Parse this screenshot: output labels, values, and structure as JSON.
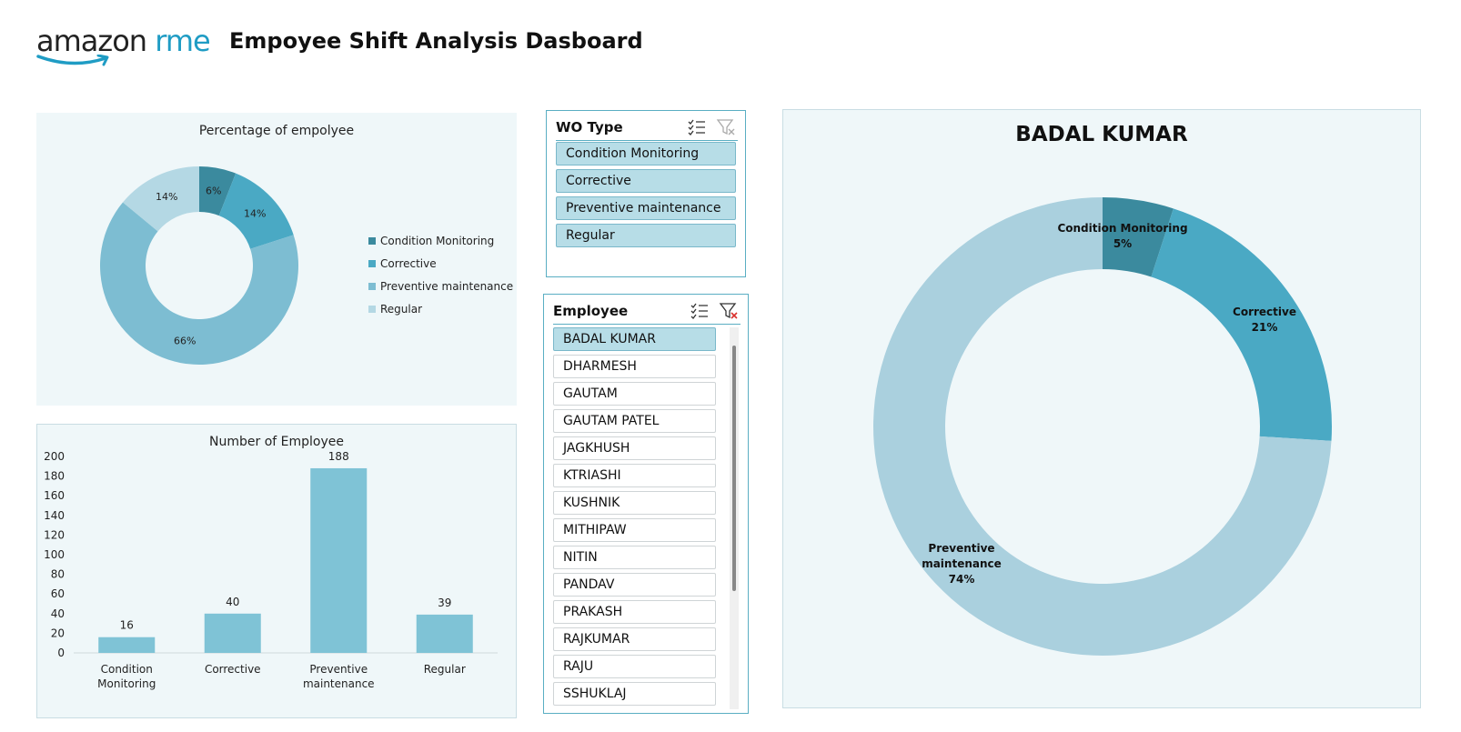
{
  "header": {
    "logo_word": "amazon",
    "logo_suffix": "rme",
    "title": "Empoyee Shift Analysis Dasboard"
  },
  "colors": {
    "condition_monitoring": "#3b8a9e",
    "corrective": "#4aa9c4",
    "preventive_maintenance": "#7dbdd2",
    "regular": "#b4d8e4",
    "big_preventive": "#aad0de",
    "bar": "#7fc3d6",
    "panel_bg": "#eff7f9",
    "slicer_border": "#5aaec3"
  },
  "wo_slicer": {
    "title": "WO Type",
    "items": [
      {
        "label": "Condition Monitoring",
        "selected": true
      },
      {
        "label": "Corrective",
        "selected": true
      },
      {
        "label": "Preventive maintenance",
        "selected": true
      },
      {
        "label": "Regular",
        "selected": true
      }
    ]
  },
  "employee_slicer": {
    "title": "Employee",
    "items": [
      {
        "label": "BADAL KUMAR",
        "selected": true
      },
      {
        "label": "DHARMESH",
        "selected": false
      },
      {
        "label": "GAUTAM",
        "selected": false
      },
      {
        "label": "GAUTAM PATEL",
        "selected": false
      },
      {
        "label": "JAGKHUSH",
        "selected": false
      },
      {
        "label": "KTRIASHI",
        "selected": false
      },
      {
        "label": "KUSHNIK",
        "selected": false
      },
      {
        "label": "MITHIPAW",
        "selected": false
      },
      {
        "label": "NITIN",
        "selected": false
      },
      {
        "label": "PANDAV",
        "selected": false
      },
      {
        "label": "PRAKASH",
        "selected": false
      },
      {
        "label": "RAJKUMAR",
        "selected": false
      },
      {
        "label": "RAJU",
        "selected": false
      },
      {
        "label": "SSHUKLAJ",
        "selected": false
      }
    ]
  },
  "chart_data": [
    {
      "type": "pie",
      "variant": "donut",
      "title": "Percentage of empolyee",
      "categories": [
        "Condition Monitoring",
        "Corrective",
        "Preventive maintenance",
        "Regular"
      ],
      "values": [
        6,
        14,
        66,
        14
      ],
      "labels": [
        "6%",
        "14%",
        "66%",
        "14%"
      ],
      "legend": "right"
    },
    {
      "type": "bar",
      "title": "Number of Employee",
      "categories": [
        "Condition Monitoring",
        "Corrective",
        "Preventive maintenance",
        "Regular"
      ],
      "category_lines": [
        [
          "Condition",
          "Monitoring"
        ],
        [
          "Corrective"
        ],
        [
          "Preventive",
          "maintenance"
        ],
        [
          "Regular"
        ]
      ],
      "values": [
        16,
        40,
        188,
        39
      ],
      "ylim": [
        0,
        200
      ],
      "yticks": [
        0,
        20,
        40,
        60,
        80,
        100,
        120,
        140,
        160,
        180,
        200
      ],
      "grid": false
    },
    {
      "type": "pie",
      "variant": "donut",
      "title": "BADAL KUMAR",
      "categories": [
        "Condition Monitoring",
        "Corrective",
        "Preventive maintenance"
      ],
      "values": [
        5,
        21,
        74
      ],
      "labels": [
        "5%",
        "21%",
        "74%"
      ],
      "label_lines": [
        [
          "Condition Monitoring",
          "5%"
        ],
        [
          "Corrective",
          "21%"
        ],
        [
          "Preventive",
          "maintenance",
          "74%"
        ]
      ],
      "legend": "none"
    }
  ]
}
